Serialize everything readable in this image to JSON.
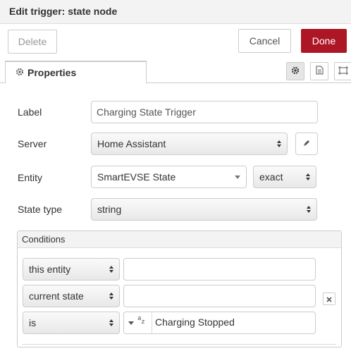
{
  "dialog": {
    "title": "Edit trigger: state node"
  },
  "tray": {
    "delete_label": "Delete",
    "cancel_label": "Cancel",
    "done_label": "Done"
  },
  "tabs": {
    "properties_label": "Properties"
  },
  "icons": {
    "properties": "gear-icon",
    "description": "document-icon",
    "appearance": "frame-icon",
    "edit": "pencil-icon",
    "remove": "close-icon"
  },
  "form": {
    "label": {
      "label": "Label",
      "value": "Charging State Trigger"
    },
    "server": {
      "label": "Server",
      "value": "Home Assistant"
    },
    "entity": {
      "label": "Entity",
      "value": "SmartEVSE State",
      "match": "exact"
    },
    "state_type": {
      "label": "State type",
      "value": "string"
    }
  },
  "conditions": {
    "title": "Conditions",
    "rows": [
      {
        "select": "this entity",
        "value": ""
      },
      {
        "select": "current state",
        "value": ""
      },
      {
        "select": "is",
        "value": "Charging Stopped",
        "type_badge": "az"
      }
    ]
  },
  "colors": {
    "accent": "#ad1625",
    "border": "#cccccc",
    "header_bg": "#f3f3f3"
  }
}
